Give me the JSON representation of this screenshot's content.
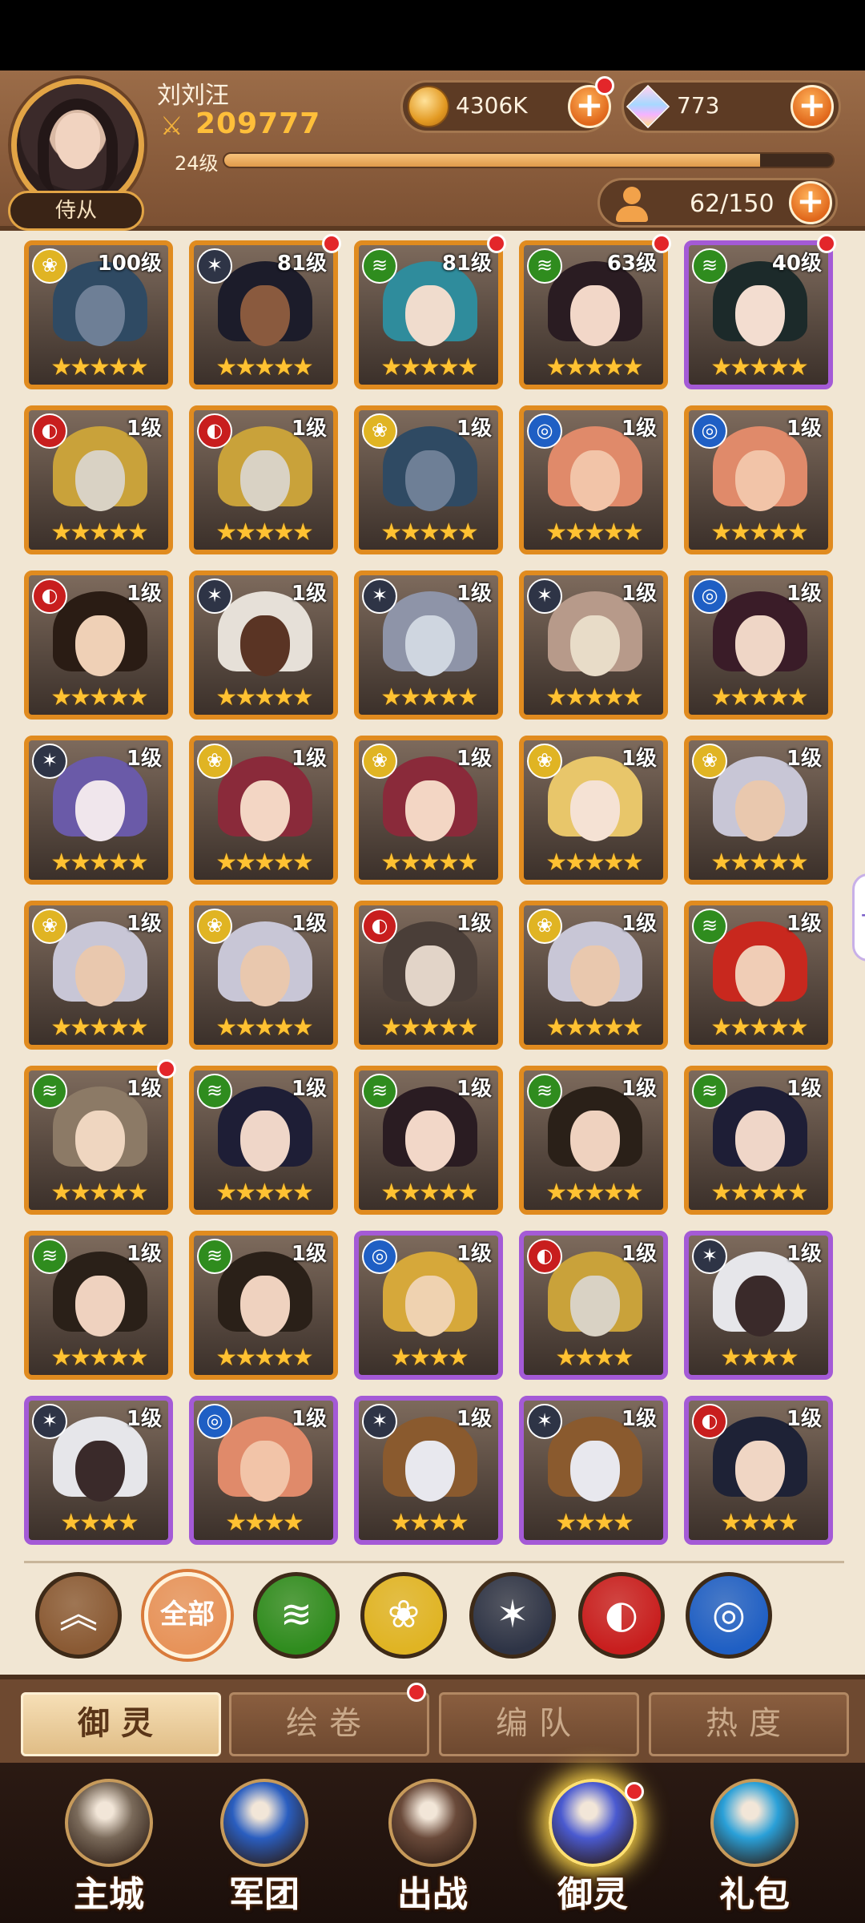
{
  "player": {
    "name": "刘刘汪",
    "power": "209777",
    "level": "24级",
    "xp_fraction": 0.88,
    "title": "侍从"
  },
  "resources": {
    "gold": "4306K",
    "gems": "773",
    "hero_count": "62/150"
  },
  "heroes": [
    {
      "level": "100级",
      "element": "gold",
      "stars": 5,
      "frame": "orange",
      "badge": false,
      "skin": "#6e7f96",
      "hair": "#2f4a63"
    },
    {
      "level": "81级",
      "element": "dark",
      "stars": 5,
      "frame": "orange",
      "badge": true,
      "skin": "#8a5a3e",
      "hair": "#1c1c2a"
    },
    {
      "level": "81级",
      "element": "wind",
      "stars": 5,
      "frame": "orange",
      "badge": true,
      "skin": "#f0dccd",
      "hair": "#2f8c9c"
    },
    {
      "level": "63级",
      "element": "wind",
      "stars": 5,
      "frame": "orange",
      "badge": true,
      "skin": "#f2d7c8",
      "hair": "#2a1c22"
    },
    {
      "level": "40级",
      "element": "wind",
      "stars": 5,
      "frame": "purple",
      "badge": true,
      "skin": "#f3ddd0",
      "hair": "#1c2a2a"
    },
    {
      "level": "1级",
      "element": "fire",
      "stars": 5,
      "frame": "orange",
      "badge": false,
      "skin": "#d9d2c4",
      "hair": "#c9a23a"
    },
    {
      "level": "1级",
      "element": "fire",
      "stars": 5,
      "frame": "orange",
      "badge": false,
      "skin": "#d9d2c4",
      "hair": "#c9a23a"
    },
    {
      "level": "1级",
      "element": "gold",
      "stars": 5,
      "frame": "orange",
      "badge": false,
      "skin": "#6e7f96",
      "hair": "#2f4a63"
    },
    {
      "level": "1级",
      "element": "water",
      "stars": 5,
      "frame": "orange",
      "badge": false,
      "skin": "#f2c4a8",
      "hair": "#e08a6a"
    },
    {
      "level": "1级",
      "element": "water",
      "stars": 5,
      "frame": "orange",
      "badge": false,
      "skin": "#f2c4a8",
      "hair": "#e08a6a"
    },
    {
      "level": "1级",
      "element": "fire",
      "stars": 5,
      "frame": "orange",
      "badge": false,
      "skin": "#efd0b6",
      "hair": "#2a1c14"
    },
    {
      "level": "1级",
      "element": "dark",
      "stars": 5,
      "frame": "orange",
      "badge": false,
      "skin": "#5a3424",
      "hair": "#e6e0d8"
    },
    {
      "level": "1级",
      "element": "dark",
      "stars": 5,
      "frame": "orange",
      "badge": false,
      "skin": "#cfd6e0",
      "hair": "#8e94a8"
    },
    {
      "level": "1级",
      "element": "dark",
      "stars": 5,
      "frame": "orange",
      "badge": false,
      "skin": "#e8dcc8",
      "hair": "#b79a8a"
    },
    {
      "level": "1级",
      "element": "water",
      "stars": 5,
      "frame": "orange",
      "badge": false,
      "skin": "#efd6c6",
      "hair": "#3a1c28"
    },
    {
      "level": "1级",
      "element": "dark",
      "stars": 5,
      "frame": "orange",
      "badge": false,
      "skin": "#f0e6ec",
      "hair": "#6a5aa8"
    },
    {
      "level": "1级",
      "element": "gold",
      "stars": 5,
      "frame": "orange",
      "badge": false,
      "skin": "#f3d6c4",
      "hair": "#8a2a3a"
    },
    {
      "level": "1级",
      "element": "gold",
      "stars": 5,
      "frame": "orange",
      "badge": false,
      "skin": "#f3d6c4",
      "hair": "#8a2a3a"
    },
    {
      "level": "1级",
      "element": "gold",
      "stars": 5,
      "frame": "orange",
      "badge": false,
      "skin": "#f5e2d4",
      "hair": "#e8c66a"
    },
    {
      "level": "1级",
      "element": "gold",
      "stars": 5,
      "frame": "orange",
      "badge": false,
      "skin": "#e9c8ae",
      "hair": "#c8c6d6"
    },
    {
      "level": "1级",
      "element": "gold",
      "stars": 5,
      "frame": "orange",
      "badge": false,
      "skin": "#e9c8ae",
      "hair": "#c8c6d6"
    },
    {
      "level": "1级",
      "element": "gold",
      "stars": 5,
      "frame": "orange",
      "badge": false,
      "skin": "#e9c8ae",
      "hair": "#c8c6d6"
    },
    {
      "level": "1级",
      "element": "fire",
      "stars": 5,
      "frame": "orange",
      "badge": false,
      "skin": "#e2d4c8",
      "hair": "#4a3e38"
    },
    {
      "level": "1级",
      "element": "gold",
      "stars": 5,
      "frame": "orange",
      "badge": false,
      "skin": "#e9c8ae",
      "hair": "#c8c6d6"
    },
    {
      "level": "1级",
      "element": "wind",
      "stars": 5,
      "frame": "orange",
      "badge": false,
      "skin": "#f0cdb6",
      "hair": "#c8281e"
    },
    {
      "level": "1级",
      "element": "wind",
      "stars": 5,
      "frame": "orange",
      "badge": true,
      "skin": "#efd6c0",
      "hair": "#8c7a66"
    },
    {
      "level": "1级",
      "element": "wind",
      "stars": 5,
      "frame": "orange",
      "badge": false,
      "skin": "#efd6c8",
      "hair": "#1e1e36"
    },
    {
      "level": "1级",
      "element": "wind",
      "stars": 5,
      "frame": "orange",
      "badge": false,
      "skin": "#f2d7c8",
      "hair": "#2a1c22"
    },
    {
      "level": "1级",
      "element": "wind",
      "stars": 5,
      "frame": "orange",
      "badge": false,
      "skin": "#efd2bf",
      "hair": "#2a2018"
    },
    {
      "level": "1级",
      "element": "wind",
      "stars": 5,
      "frame": "orange",
      "badge": false,
      "skin": "#efd6c8",
      "hair": "#1e1e36"
    },
    {
      "level": "1级",
      "element": "wind",
      "stars": 5,
      "frame": "orange",
      "badge": false,
      "skin": "#efd2bf",
      "hair": "#2a2018"
    },
    {
      "level": "1级",
      "element": "wind",
      "stars": 5,
      "frame": "orange",
      "badge": false,
      "skin": "#efd2bf",
      "hair": "#2a2018"
    },
    {
      "level": "1级",
      "element": "water",
      "stars": 4,
      "frame": "purple",
      "badge": false,
      "skin": "#efd2b0",
      "hair": "#d6a83a"
    },
    {
      "level": "1级",
      "element": "fire",
      "stars": 4,
      "frame": "purple",
      "badge": false,
      "skin": "#d9d2c4",
      "hair": "#c9a23a"
    },
    {
      "level": "1级",
      "element": "dark",
      "stars": 4,
      "frame": "purple",
      "badge": false,
      "skin": "#3a2a2a",
      "hair": "#e6e6ea"
    },
    {
      "level": "1级",
      "element": "dark",
      "stars": 4,
      "frame": "purple",
      "badge": false,
      "skin": "#3a2a2a",
      "hair": "#e6e6ea"
    },
    {
      "level": "1级",
      "element": "water",
      "stars": 4,
      "frame": "purple",
      "badge": false,
      "skin": "#f2c4a8",
      "hair": "#e08a6a"
    },
    {
      "level": "1级",
      "element": "dark",
      "stars": 4,
      "frame": "purple",
      "badge": false,
      "skin": "#e8e8ee",
      "hair": "#8a5a2e"
    },
    {
      "level": "1级",
      "element": "dark",
      "stars": 4,
      "frame": "purple",
      "badge": false,
      "skin": "#e8e8ee",
      "hair": "#8a5a2e"
    },
    {
      "level": "1级",
      "element": "fire",
      "stars": 4,
      "frame": "purple",
      "badge": false,
      "skin": "#f0d6c4",
      "hair": "#1e2236"
    }
  ],
  "filters": [
    {
      "name": "collapse",
      "label": "",
      "icon": "double-chevron-up-icon",
      "color": "#8a5a34"
    },
    {
      "name": "all",
      "label": "全部",
      "icon": "all-filter",
      "color": "#e7935a"
    },
    {
      "name": "wind",
      "label": "",
      "icon": "wind-element-icon",
      "color": "#2f8c1e"
    },
    {
      "name": "gold",
      "label": "",
      "icon": "rose-element-icon",
      "color": "#e0b423"
    },
    {
      "name": "dark",
      "label": "",
      "icon": "star-web-element-icon",
      "color": "#2e3446"
    },
    {
      "name": "fire",
      "label": "",
      "icon": "fire-element-icon",
      "color": "#c81e1e"
    },
    {
      "name": "water",
      "label": "",
      "icon": "water-element-icon",
      "color": "#1f5fc4"
    }
  ],
  "tabs": [
    {
      "label": "御灵",
      "active": true,
      "badge": false
    },
    {
      "label": "绘卷",
      "active": false,
      "badge": true
    },
    {
      "label": "编队",
      "active": false,
      "badge": false
    },
    {
      "label": "热度",
      "active": false,
      "badge": false
    }
  ],
  "nav": [
    {
      "label": "主城",
      "icon": "castle-angel-icon",
      "active": false,
      "badge": false
    },
    {
      "label": "军团",
      "icon": "fist-shield-icon",
      "active": false,
      "badge": false
    },
    {
      "label": "出战",
      "icon": "battle-gate-icon",
      "active": false,
      "badge": false
    },
    {
      "label": "御灵",
      "icon": "crystal-icon",
      "active": true,
      "badge": true
    },
    {
      "label": "礼包",
      "icon": "gift-shop-icon",
      "active": false,
      "badge": false
    }
  ],
  "colors": {
    "frame_orange": "#e08b1f",
    "frame_purple": "#a45ad6",
    "element_gold": "#e0b423",
    "element_wind": "#2f8c1e",
    "element_dark": "#2e3446",
    "element_fire": "#c81e1e",
    "element_water": "#1f5fc4"
  }
}
